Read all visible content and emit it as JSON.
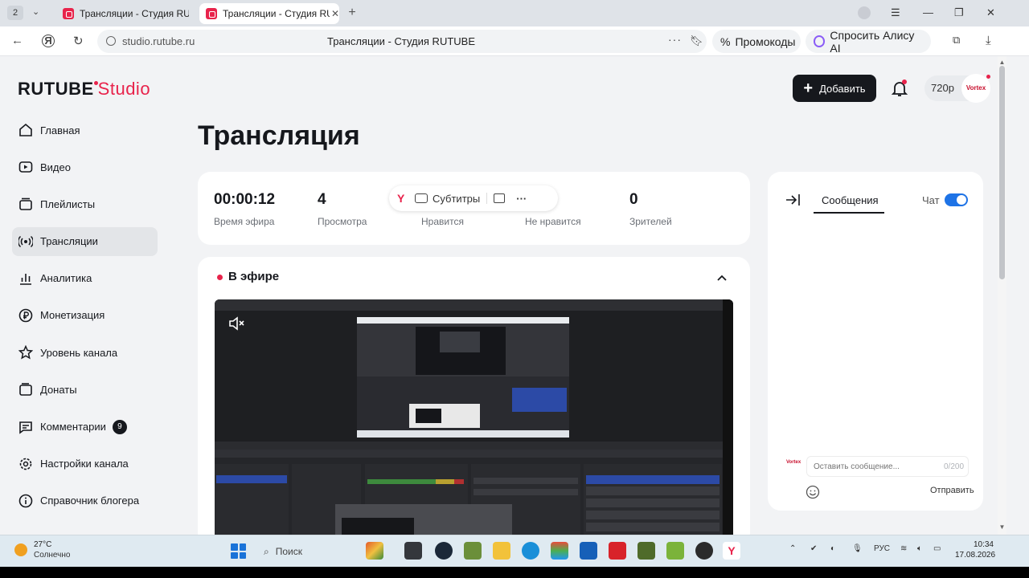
{
  "browser": {
    "tab_count": "2",
    "tabs": [
      {
        "title": "Трансляции - Студия RUTUBE"
      },
      {
        "title": "Трансляции - Студия RUTUBE"
      }
    ],
    "url": "studio.rutube.ru",
    "page_title": "Трансляции - Студия RUTUBE",
    "promo_label": "Промокоды",
    "alice_label": "Спросить Алису AI"
  },
  "header": {
    "logo_main": "RUTUBE",
    "logo_sub": "Studio",
    "add_button": "Добавить",
    "quality": "720p",
    "avatar_text": "Vortex",
    "accent_color": "#e8234b"
  },
  "sidebar": {
    "items": [
      {
        "label": "Главная",
        "icon": "home-icon"
      },
      {
        "label": "Видео",
        "icon": "video-icon"
      },
      {
        "label": "Плейлисты",
        "icon": "playlist-icon"
      },
      {
        "label": "Трансляции",
        "icon": "broadcast-icon",
        "active": true
      },
      {
        "label": "Аналитика",
        "icon": "analytics-icon"
      },
      {
        "label": "Монетизация",
        "icon": "ruble-icon"
      },
      {
        "label": "Уровень канала",
        "icon": "star-icon"
      },
      {
        "label": "Донаты",
        "icon": "wallet-icon"
      },
      {
        "label": "Комментарии",
        "icon": "comment-icon",
        "badge": "9"
      },
      {
        "label": "Настройки канала",
        "icon": "gear-icon"
      },
      {
        "label": "Справочник блогера",
        "icon": "book-icon"
      }
    ]
  },
  "main": {
    "title": "Трансляция",
    "stats": [
      {
        "value": "00:00:12",
        "label": "Время эфира"
      },
      {
        "value": "4",
        "label": "Просмотра"
      },
      {
        "value": "",
        "label": "Нравится"
      },
      {
        "value": "",
        "label": "Не нравится"
      },
      {
        "value": "0",
        "label": "Зрителей"
      }
    ],
    "toolbar": {
      "subtitles": "Субтитры",
      "more": "···"
    },
    "live_title": "В эфире"
  },
  "chat": {
    "tab_messages": "Сообщения",
    "chat_label": "Чат",
    "chat_enabled": true,
    "avatar_text": "Vortex",
    "input_placeholder": "Оставить сообщение...",
    "counter": "0/200",
    "send_label": "Отправить"
  },
  "taskbar": {
    "temperature": "27°C",
    "weather": "Солнечно",
    "search": "Поиск",
    "lang": "РУС",
    "time": "10:34",
    "date": "17.08.2026"
  }
}
